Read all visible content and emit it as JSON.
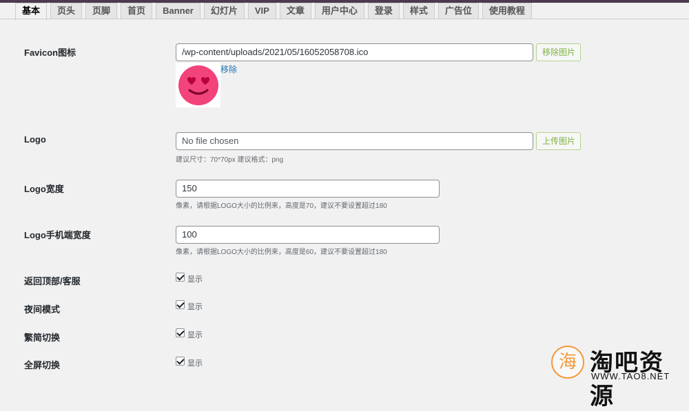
{
  "tabs": [
    {
      "label": "基本",
      "active": true
    },
    {
      "label": "页头"
    },
    {
      "label": "页脚"
    },
    {
      "label": "首页"
    },
    {
      "label": "Banner"
    },
    {
      "label": "幻灯片"
    },
    {
      "label": "VIP"
    },
    {
      "label": "文章"
    },
    {
      "label": "用户中心"
    },
    {
      "label": "登录"
    },
    {
      "label": "样式"
    },
    {
      "label": "广告位"
    },
    {
      "label": "使用教程"
    }
  ],
  "favicon": {
    "label": "Favicon图标",
    "value": "/wp-content/uploads/2021/05/16052058708.ico",
    "button": "移除图片",
    "remove_link": "移除"
  },
  "logo": {
    "label": "Logo",
    "value": "No file chosen",
    "button": "上传图片",
    "hint": "建议尺寸：70*70px 建议格式：png"
  },
  "logo_width": {
    "label": "Logo宽度",
    "value": "150",
    "hint": "像素，请根据LOGO大小的比例来，高度是70，建议不要设置超过180"
  },
  "logo_mobile_width": {
    "label": "Logo手机端宽度",
    "value": "100",
    "hint": "像素，请根据LOGO大小的比例来，高度是60，建议不要设置超过180"
  },
  "toggles": [
    {
      "label": "返回顶部/客服",
      "option": "显示",
      "checked": true
    },
    {
      "label": "夜间模式",
      "option": "显示",
      "checked": true
    },
    {
      "label": "繁简切换",
      "option": "显示",
      "checked": true
    },
    {
      "label": "全屏切换",
      "option": "显示",
      "checked": true
    }
  ],
  "watermark": {
    "glyph": "海",
    "title": "淘吧资源",
    "url": "WWW.TAO8.NET"
  },
  "colors": {
    "accent_button": "#7fb33f",
    "link": "#2271b1",
    "topbar": "#4a3b4f",
    "watermark_orange": "#f39a3c"
  }
}
